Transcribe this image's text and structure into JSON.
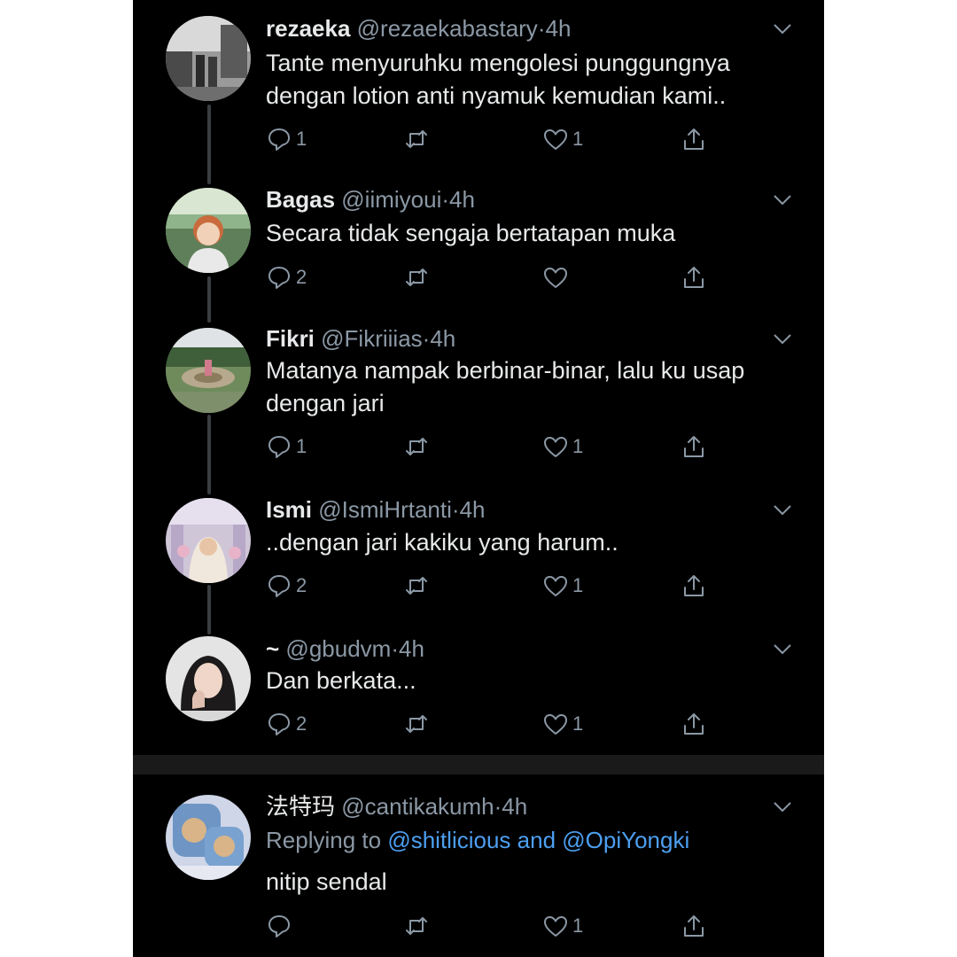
{
  "thread": [
    {
      "name": "rezaeka",
      "handle": "@rezaekabastary",
      "time": "4h",
      "lines": [
        "Tante menyuruhku mengolesi punggungnya",
        "dengan lotion anti nyamuk kemudian kami.."
      ],
      "reply_count": "1",
      "like_count": "1"
    },
    {
      "name": "Bagas",
      "handle": "@iimiyoui",
      "time": "4h",
      "lines": [
        "Secara tidak sengaja bertatapan muka"
      ],
      "reply_count": "2",
      "like_count": ""
    },
    {
      "name": "Fikri",
      "handle": "@Fikriiias",
      "time": "4h",
      "lines": [
        "Matanya nampak berbinar-binar, lalu ku usap",
        "dengan jari"
      ],
      "reply_count": "1",
      "like_count": "1"
    },
    {
      "name": "Ismi",
      "handle": "@IsmiHrtanti",
      "time": "4h",
      "lines": [
        "..dengan jari kakiku yang harum.."
      ],
      "reply_count": "2",
      "like_count": "1"
    },
    {
      "name": "~",
      "handle": "@gbudvm",
      "time": "4h",
      "lines": [
        "Dan berkata..."
      ],
      "reply_count": "2",
      "like_count": "1"
    }
  ],
  "reply": {
    "name": "法特玛",
    "handle": "@cantikakumh",
    "time": "4h",
    "replying_prefix": "Replying to",
    "mention_1": "@shitlicious",
    "conjunction": "and",
    "mention_2": "@OpiYongki",
    "text": "nitip sendal",
    "reply_count": "",
    "like_count": "1"
  },
  "separator_dot": "·",
  "colors": {
    "background": "#000000",
    "text": "#e7e9ea",
    "secondary": "#8b98a5",
    "link": "#4d9ff0"
  },
  "icons": [
    "reply-icon",
    "retweet-icon",
    "like-icon",
    "share-icon",
    "chevron-down-icon"
  ]
}
